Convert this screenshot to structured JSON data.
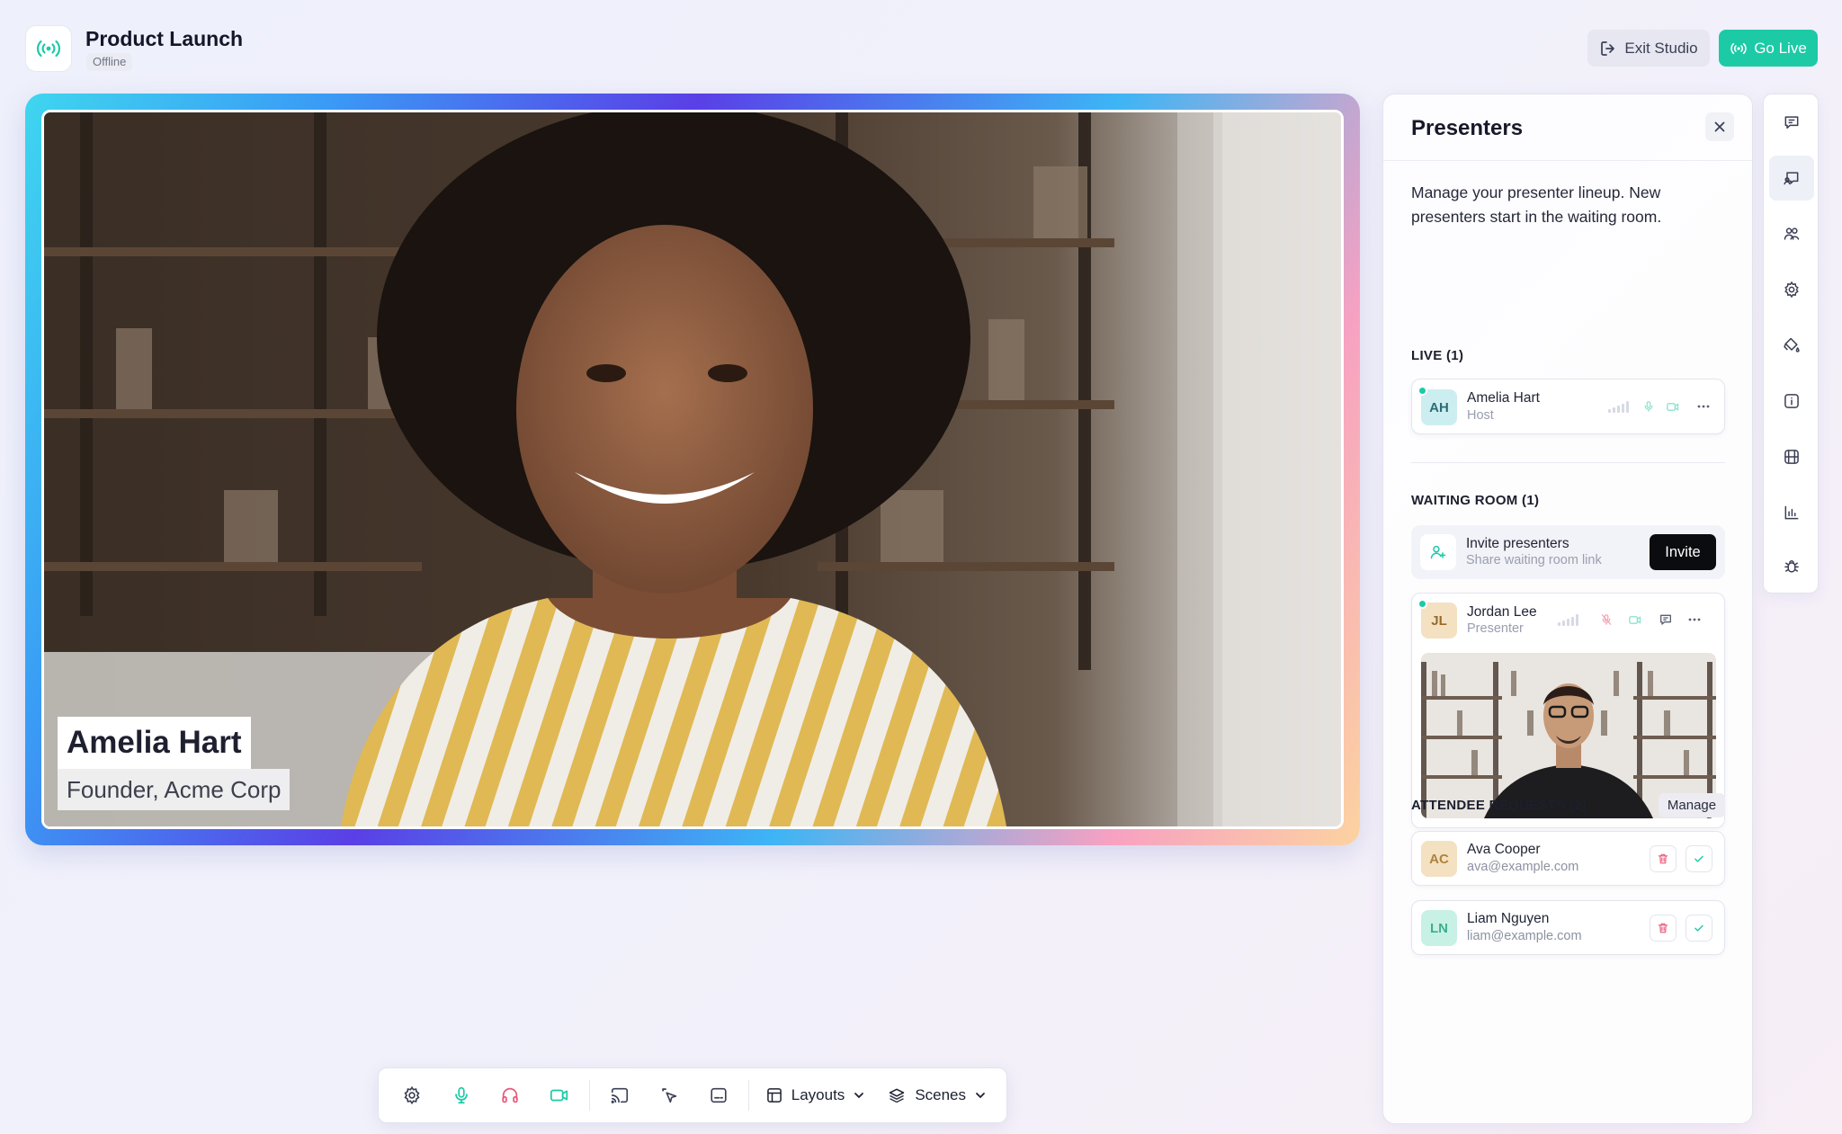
{
  "header": {
    "title": "Product Launch",
    "status": "Offline",
    "exit_label": "Exit Studio",
    "golive_label": "Go Live"
  },
  "stage": {
    "name": "Amelia Hart",
    "subtitle": "Founder, Acme Corp"
  },
  "toolbar": {
    "layouts_label": "Layouts",
    "scenes_label": "Scenes"
  },
  "panel": {
    "title": "Presenters",
    "description": "Manage your presenter lineup. New presenters start in the waiting room.",
    "live_label": "LIVE (1)",
    "live": [
      {
        "initials": "AH",
        "name": "Amelia Hart",
        "role": "Host"
      }
    ],
    "waiting_label": "WAITING ROOM (1)",
    "invite": {
      "title": "Invite presenters",
      "subtitle": "Share waiting room link",
      "button": "Invite"
    },
    "waiting": [
      {
        "initials": "JL",
        "name": "Jordan Lee",
        "role": "Presenter"
      }
    ],
    "requests_label": "ATTENDEE REQUESTS (2)",
    "manage_label": "Manage",
    "requests": [
      {
        "initials": "AC",
        "name": "Ava Cooper",
        "email": "ava@example.com"
      },
      {
        "initials": "LN",
        "name": "Liam Nguyen",
        "email": "liam@example.com"
      }
    ]
  },
  "colors": {
    "accent": "#1ccaa6",
    "danger": "#e8587a",
    "dark": "#0b0c10"
  },
  "icons": [
    "broadcast-icon",
    "exit-icon",
    "settings-icon",
    "microphone-icon",
    "headphones-icon",
    "camera-icon",
    "cast-icon",
    "pointer-icon",
    "captions-icon",
    "layout-icon",
    "layers-icon",
    "close-icon",
    "chat-icon",
    "presenters-icon",
    "people-icon",
    "brush-icon",
    "info-icon",
    "media-icon",
    "chart-icon",
    "bug-icon",
    "signal-icon",
    "more-icon",
    "trash-icon",
    "check-icon",
    "user-plus-icon"
  ]
}
